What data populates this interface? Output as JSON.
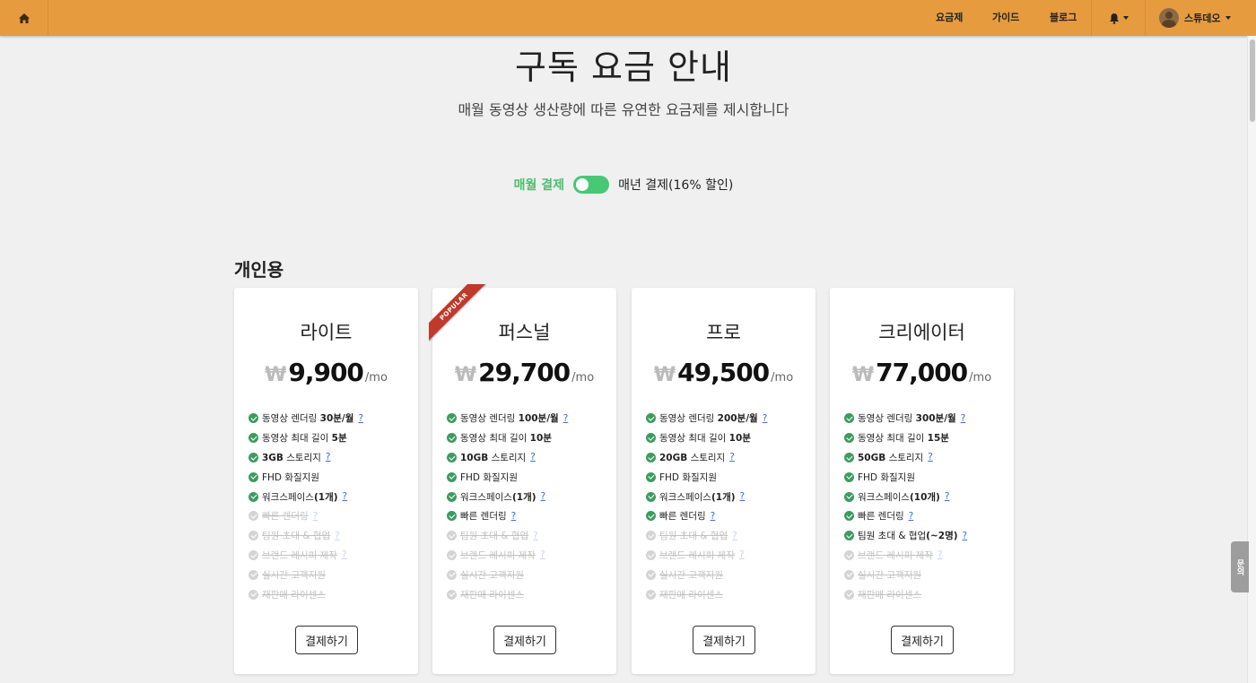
{
  "nav": {
    "links": [
      "요금제",
      "가이드",
      "블로그"
    ],
    "user_name": "스튜데오"
  },
  "header": {
    "title": "구독 요금 안내",
    "subtitle": "매월 동영상 생산량에 따른 유연한 요금제를 제시합니다"
  },
  "billing": {
    "monthly_label": "매월 결제",
    "yearly_label": "매년 결제(16% 할인)",
    "toggle_state": "monthly"
  },
  "section": {
    "title": "개인용"
  },
  "plans": [
    {
      "name": "라이트",
      "currency": "₩",
      "price": "9,900",
      "per": "/mo",
      "button": "결제하기",
      "badge": "",
      "features": [
        {
          "pre": "동영상 렌더링 ",
          "bold": "30분/월",
          "post": "",
          "help": "?",
          "on": true
        },
        {
          "pre": "동영상 최대 길이 ",
          "bold": "5분",
          "post": "",
          "help": "",
          "on": true
        },
        {
          "pre": "",
          "bold": "3GB",
          "post": " 스토리지",
          "help": "?",
          "on": true
        },
        {
          "pre": "FHD 화질지원",
          "bold": "",
          "post": "",
          "help": "",
          "on": true
        },
        {
          "pre": "워크스페이스",
          "bold": "(1개)",
          "post": "",
          "help": "?",
          "on": true
        },
        {
          "pre": "빠른 렌더링",
          "bold": "",
          "post": "",
          "help": "?",
          "on": false
        },
        {
          "pre": "팀원 초대 & 협업",
          "bold": "",
          "post": "",
          "help": "?",
          "on": false
        },
        {
          "pre": "브랜드 레시피 제작",
          "bold": "",
          "post": "",
          "help": "?",
          "on": false
        },
        {
          "pre": "실시간 고객지원",
          "bold": "",
          "post": "",
          "help": "",
          "on": false
        },
        {
          "pre": "재판매 라이센스",
          "bold": "",
          "post": "",
          "help": "",
          "on": false
        }
      ]
    },
    {
      "name": "퍼스널",
      "currency": "₩",
      "price": "29,700",
      "per": "/mo",
      "button": "결제하기",
      "badge": "POPULAR",
      "features": [
        {
          "pre": "동영상 렌더링 ",
          "bold": "100분/월",
          "post": "",
          "help": "?",
          "on": true
        },
        {
          "pre": "동영상 최대 길이 ",
          "bold": "10분",
          "post": "",
          "help": "",
          "on": true
        },
        {
          "pre": "",
          "bold": "10GB",
          "post": " 스토리지",
          "help": "?",
          "on": true
        },
        {
          "pre": "FHD 화질지원",
          "bold": "",
          "post": "",
          "help": "",
          "on": true
        },
        {
          "pre": "워크스페이스",
          "bold": "(1개)",
          "post": "",
          "help": "?",
          "on": true
        },
        {
          "pre": "빠른 렌더링",
          "bold": "",
          "post": "",
          "help": "?",
          "on": true
        },
        {
          "pre": "팀원 초대 & 협업",
          "bold": "",
          "post": "",
          "help": "?",
          "on": false
        },
        {
          "pre": "브랜드 레시피 제작",
          "bold": "",
          "post": "",
          "help": "?",
          "on": false
        },
        {
          "pre": "실시간 고객지원",
          "bold": "",
          "post": "",
          "help": "",
          "on": false
        },
        {
          "pre": "재판매 라이센스",
          "bold": "",
          "post": "",
          "help": "",
          "on": false
        }
      ]
    },
    {
      "name": "프로",
      "currency": "₩",
      "price": "49,500",
      "per": "/mo",
      "button": "결제하기",
      "badge": "",
      "features": [
        {
          "pre": "동영상 렌더링 ",
          "bold": "200분/월",
          "post": "",
          "help": "?",
          "on": true
        },
        {
          "pre": "동영상 최대 길이 ",
          "bold": "10분",
          "post": "",
          "help": "",
          "on": true
        },
        {
          "pre": "",
          "bold": "20GB",
          "post": " 스토리지",
          "help": "?",
          "on": true
        },
        {
          "pre": "FHD 화질지원",
          "bold": "",
          "post": "",
          "help": "",
          "on": true
        },
        {
          "pre": "워크스페이스",
          "bold": "(1개)",
          "post": "",
          "help": "?",
          "on": true
        },
        {
          "pre": "빠른 렌더링",
          "bold": "",
          "post": "",
          "help": "?",
          "on": true
        },
        {
          "pre": "팀원 초대 & 협업",
          "bold": "",
          "post": "",
          "help": "?",
          "on": false
        },
        {
          "pre": "브랜드 레시피 제작",
          "bold": "",
          "post": "",
          "help": "?",
          "on": false
        },
        {
          "pre": "실시간 고객지원",
          "bold": "",
          "post": "",
          "help": "",
          "on": false
        },
        {
          "pre": "재판매 라이센스",
          "bold": "",
          "post": "",
          "help": "",
          "on": false
        }
      ]
    },
    {
      "name": "크리에이터",
      "currency": "₩",
      "price": "77,000",
      "per": "/mo",
      "button": "결제하기",
      "badge": "",
      "features": [
        {
          "pre": "동영상 렌더링 ",
          "bold": "300분/월",
          "post": "",
          "help": "?",
          "on": true
        },
        {
          "pre": "동영상 최대 길이 ",
          "bold": "15분",
          "post": "",
          "help": "",
          "on": true
        },
        {
          "pre": "",
          "bold": "50GB",
          "post": " 스토리지",
          "help": "?",
          "on": true
        },
        {
          "pre": "FHD 화질지원",
          "bold": "",
          "post": "",
          "help": "",
          "on": true
        },
        {
          "pre": "워크스페이스",
          "bold": "(10개)",
          "post": "",
          "help": "?",
          "on": true
        },
        {
          "pre": "빠른 렌더링",
          "bold": "",
          "post": "",
          "help": "?",
          "on": true
        },
        {
          "pre": "팀원 초대 & 협업",
          "bold": "(~2명)",
          "post": "",
          "help": "?",
          "on": true
        },
        {
          "pre": "브랜드 레시피 제작",
          "bold": "",
          "post": "",
          "help": "?",
          "on": false
        },
        {
          "pre": "실시간 고객지원",
          "bold": "",
          "post": "",
          "help": "",
          "on": false
        },
        {
          "pre": "재판매 라이센스",
          "bold": "",
          "post": "",
          "help": "",
          "on": false
        }
      ]
    }
  ],
  "contact_tab": "문의",
  "colors": {
    "nav_bg": "#e69b3e",
    "accent_green": "#48c774",
    "check_green": "#3d9b60",
    "ribbon_red": "#c0392b",
    "help_link": "#3a6fd8"
  }
}
